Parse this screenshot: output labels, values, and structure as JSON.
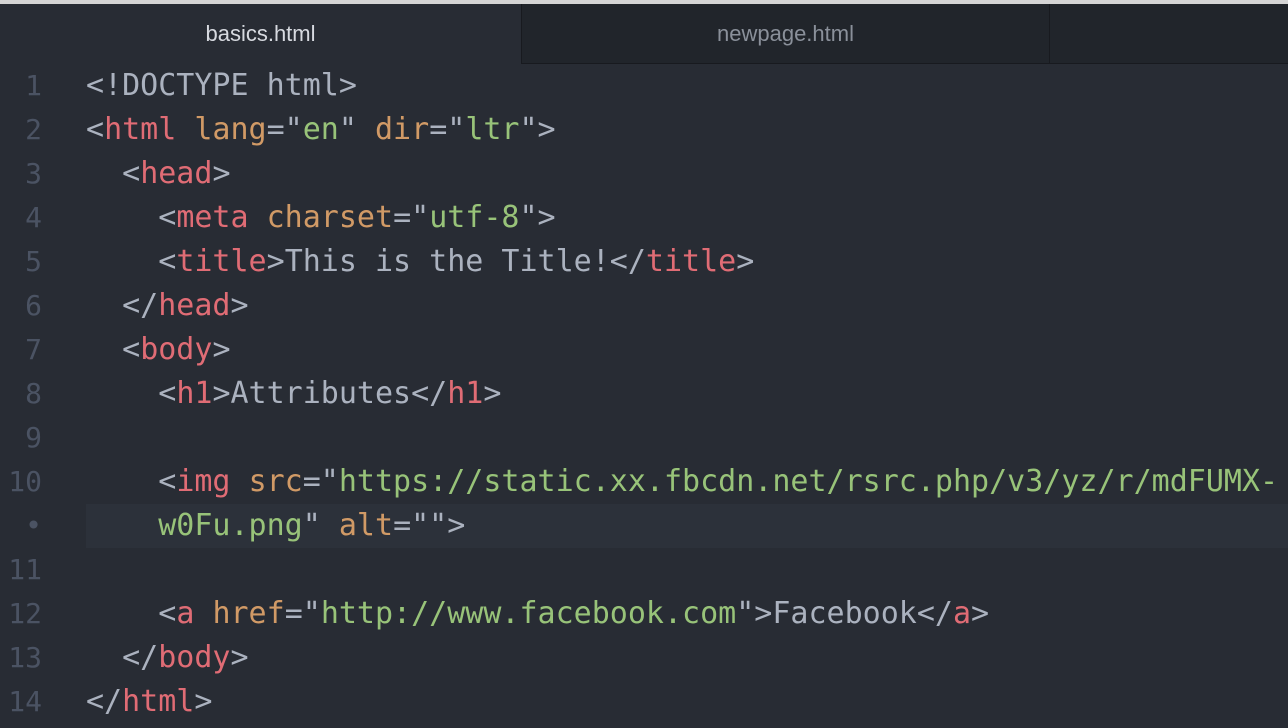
{
  "tabs": [
    {
      "label": "basics.html",
      "active": true
    },
    {
      "label": "newpage.html",
      "active": false
    }
  ],
  "colors": {
    "background": "#282c34",
    "tag": "#e06c75",
    "attribute": "#d19a66",
    "string": "#98c379",
    "punctuation": "#abb2bf"
  },
  "editor": {
    "lines": [
      {
        "num": "1",
        "indent": 0,
        "tokens": [
          [
            "p",
            "<!DOCTYPE html>"
          ]
        ]
      },
      {
        "num": "2",
        "indent": 0,
        "tokens": [
          [
            "p",
            "<"
          ],
          [
            "tag",
            "html"
          ],
          [
            "p",
            " "
          ],
          [
            "attr",
            "lang"
          ],
          [
            "p",
            "=\""
          ],
          [
            "str",
            "en"
          ],
          [
            "p",
            "\" "
          ],
          [
            "attr",
            "dir"
          ],
          [
            "p",
            "=\""
          ],
          [
            "str",
            "ltr"
          ],
          [
            "p",
            "\">"
          ]
        ]
      },
      {
        "num": "3",
        "indent": 1,
        "tokens": [
          [
            "p",
            "<"
          ],
          [
            "tag",
            "head"
          ],
          [
            "p",
            ">"
          ]
        ]
      },
      {
        "num": "4",
        "indent": 2,
        "tokens": [
          [
            "p",
            "<"
          ],
          [
            "tag",
            "meta"
          ],
          [
            "p",
            " "
          ],
          [
            "attr",
            "charset"
          ],
          [
            "p",
            "=\""
          ],
          [
            "str",
            "utf-8"
          ],
          [
            "p",
            "\">"
          ]
        ]
      },
      {
        "num": "5",
        "indent": 2,
        "tokens": [
          [
            "p",
            "<"
          ],
          [
            "tag",
            "title"
          ],
          [
            "p",
            ">"
          ],
          [
            "text",
            "This is the Title!"
          ],
          [
            "p",
            "</"
          ],
          [
            "tag",
            "title"
          ],
          [
            "p",
            ">"
          ]
        ]
      },
      {
        "num": "6",
        "indent": 1,
        "tokens": [
          [
            "p",
            "</"
          ],
          [
            "tag",
            "head"
          ],
          [
            "p",
            ">"
          ]
        ]
      },
      {
        "num": "7",
        "indent": 1,
        "tokens": [
          [
            "p",
            "<"
          ],
          [
            "tag",
            "body"
          ],
          [
            "p",
            ">"
          ]
        ]
      },
      {
        "num": "8",
        "indent": 2,
        "tokens": [
          [
            "p",
            "<"
          ],
          [
            "tag",
            "h1"
          ],
          [
            "p",
            ">"
          ],
          [
            "text",
            "Attributes"
          ],
          [
            "p",
            "</"
          ],
          [
            "tag",
            "h1"
          ],
          [
            "p",
            ">"
          ]
        ]
      },
      {
        "num": "9",
        "indent": 0,
        "tokens": []
      },
      {
        "num": "10",
        "indent": 2,
        "tokens": [
          [
            "p",
            "<"
          ],
          [
            "tag",
            "img"
          ],
          [
            "p",
            " "
          ],
          [
            "attr",
            "src"
          ],
          [
            "p",
            "=\""
          ],
          [
            "str",
            "https://static.xx.fbcdn.net/rsrc.php/v3/yz/r/mdFUMX-"
          ]
        ]
      },
      {
        "num": "•",
        "indent": 2,
        "cursor": true,
        "tokens": [
          [
            "str",
            "w0Fu.png"
          ],
          [
            "p",
            "\" "
          ],
          [
            "attr",
            "alt"
          ],
          [
            "p",
            "=\"\">"
          ]
        ]
      },
      {
        "num": "11",
        "indent": 0,
        "tokens": []
      },
      {
        "num": "12",
        "indent": 2,
        "tokens": [
          [
            "p",
            "<"
          ],
          [
            "tag",
            "a"
          ],
          [
            "p",
            " "
          ],
          [
            "attr",
            "href"
          ],
          [
            "p",
            "=\""
          ],
          [
            "str",
            "http://www.facebook.com"
          ],
          [
            "p",
            "\">"
          ],
          [
            "text",
            "Facebook"
          ],
          [
            "p",
            "</"
          ],
          [
            "tag",
            "a"
          ],
          [
            "p",
            ">"
          ]
        ]
      },
      {
        "num": "13",
        "indent": 1,
        "tokens": [
          [
            "p",
            "</"
          ],
          [
            "tag",
            "body"
          ],
          [
            "p",
            ">"
          ]
        ]
      },
      {
        "num": "14",
        "indent": 0,
        "tokens": [
          [
            "p",
            "</"
          ],
          [
            "tag",
            "html"
          ],
          [
            "p",
            ">"
          ]
        ]
      }
    ]
  }
}
